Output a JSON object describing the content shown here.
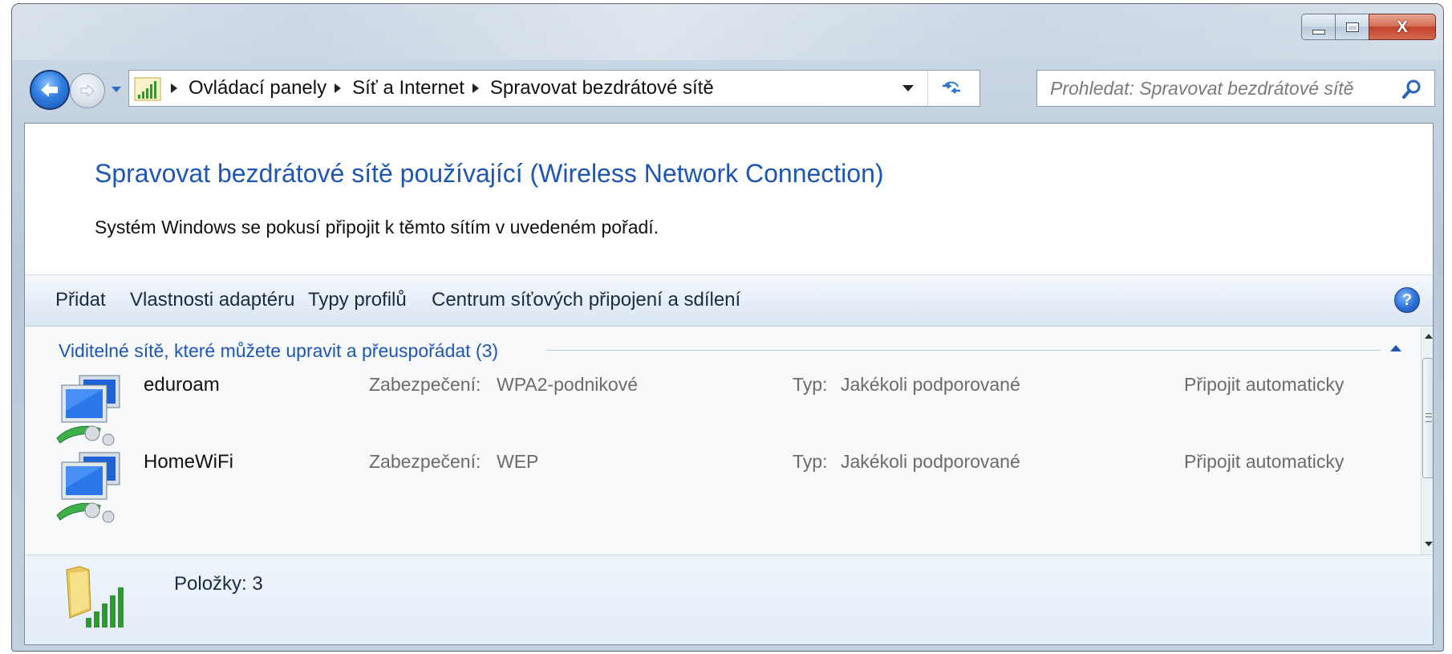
{
  "window": {
    "caption": {
      "close_glyph": "X"
    }
  },
  "address_bar": {
    "breadcrumbs": [
      "Ovládací panely",
      "Síť a Internet",
      "Spravovat bezdrátové sítě"
    ]
  },
  "search": {
    "placeholder": "Prohledat: Spravovat bezdrátové sítě"
  },
  "page": {
    "heading": "Spravovat bezdrátové sítě používající (Wireless Network Connection)",
    "description": "Systém Windows se pokusí připojit k těmto sítím v uvedeném pořadí."
  },
  "toolbar": {
    "items": [
      "Přidat",
      "Vlastnosti adaptéru",
      "Typy profilů",
      "Centrum síťových připojení a sdílení"
    ],
    "help_glyph": "?"
  },
  "networks": {
    "group_title": "Viditelné sítě, které můžete upravit a přeuspořádat (3)",
    "items": [
      {
        "name": "eduroam",
        "security_label": "Zabezpečení:",
        "security": "WPA2-podnikové",
        "type_label": "Typ:",
        "type": "Jakékoli podporované",
        "connect": "Připojit automaticky"
      },
      {
        "name": "HomeWiFi",
        "security_label": "Zabezpečení:",
        "security": "WEP",
        "type_label": "Typ:",
        "type": "Jakékoli podporované",
        "connect": "Připojit automaticky"
      }
    ]
  },
  "details": {
    "count": "Položky: 3"
  },
  "colors": {
    "heading": "#1e56b4",
    "link": "#1e56b4",
    "muted": "#6b6b6b"
  }
}
